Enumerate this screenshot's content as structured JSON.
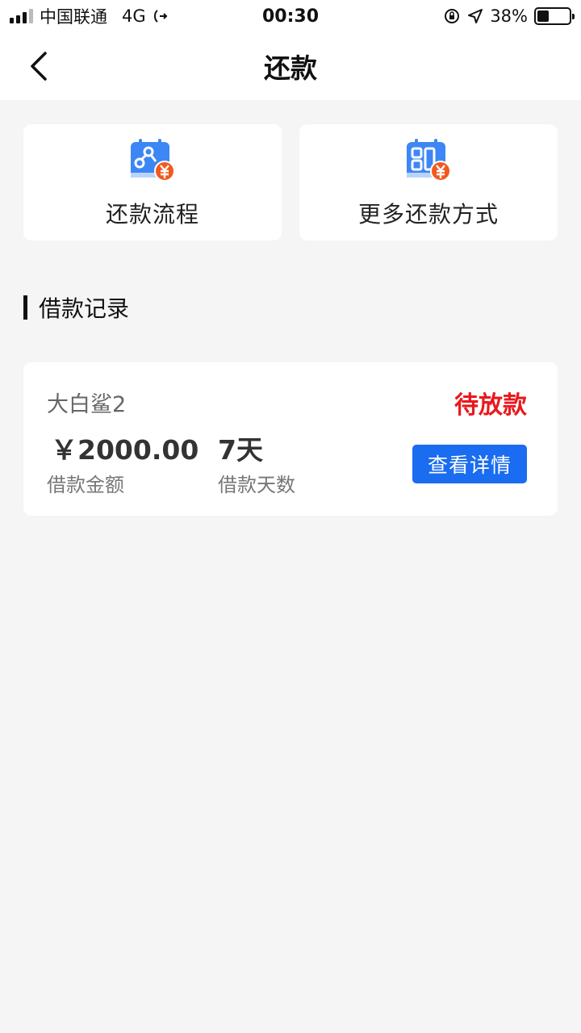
{
  "status_bar": {
    "carrier": "中国联通",
    "network": "4G",
    "time": "00:30",
    "battery_percent": "38%",
    "battery_level": 0.38
  },
  "nav": {
    "title": "还款"
  },
  "quick_actions": [
    {
      "label": "还款流程",
      "icon": "repayment-flow-icon"
    },
    {
      "label": "更多还款方式",
      "icon": "repayment-methods-icon"
    }
  ],
  "section": {
    "title": "借款记录"
  },
  "loan": {
    "name": "大白鲨2",
    "status": "待放款",
    "amount": "￥2000.00",
    "amount_label": "借款金额",
    "days": "7天",
    "days_label": "借款天数",
    "detail_button": "查看详情"
  },
  "colors": {
    "accent_blue": "#1a6cf0",
    "status_red": "#e8191e",
    "icon_orange": "#f05a1e",
    "background": "#f5f5f5"
  }
}
